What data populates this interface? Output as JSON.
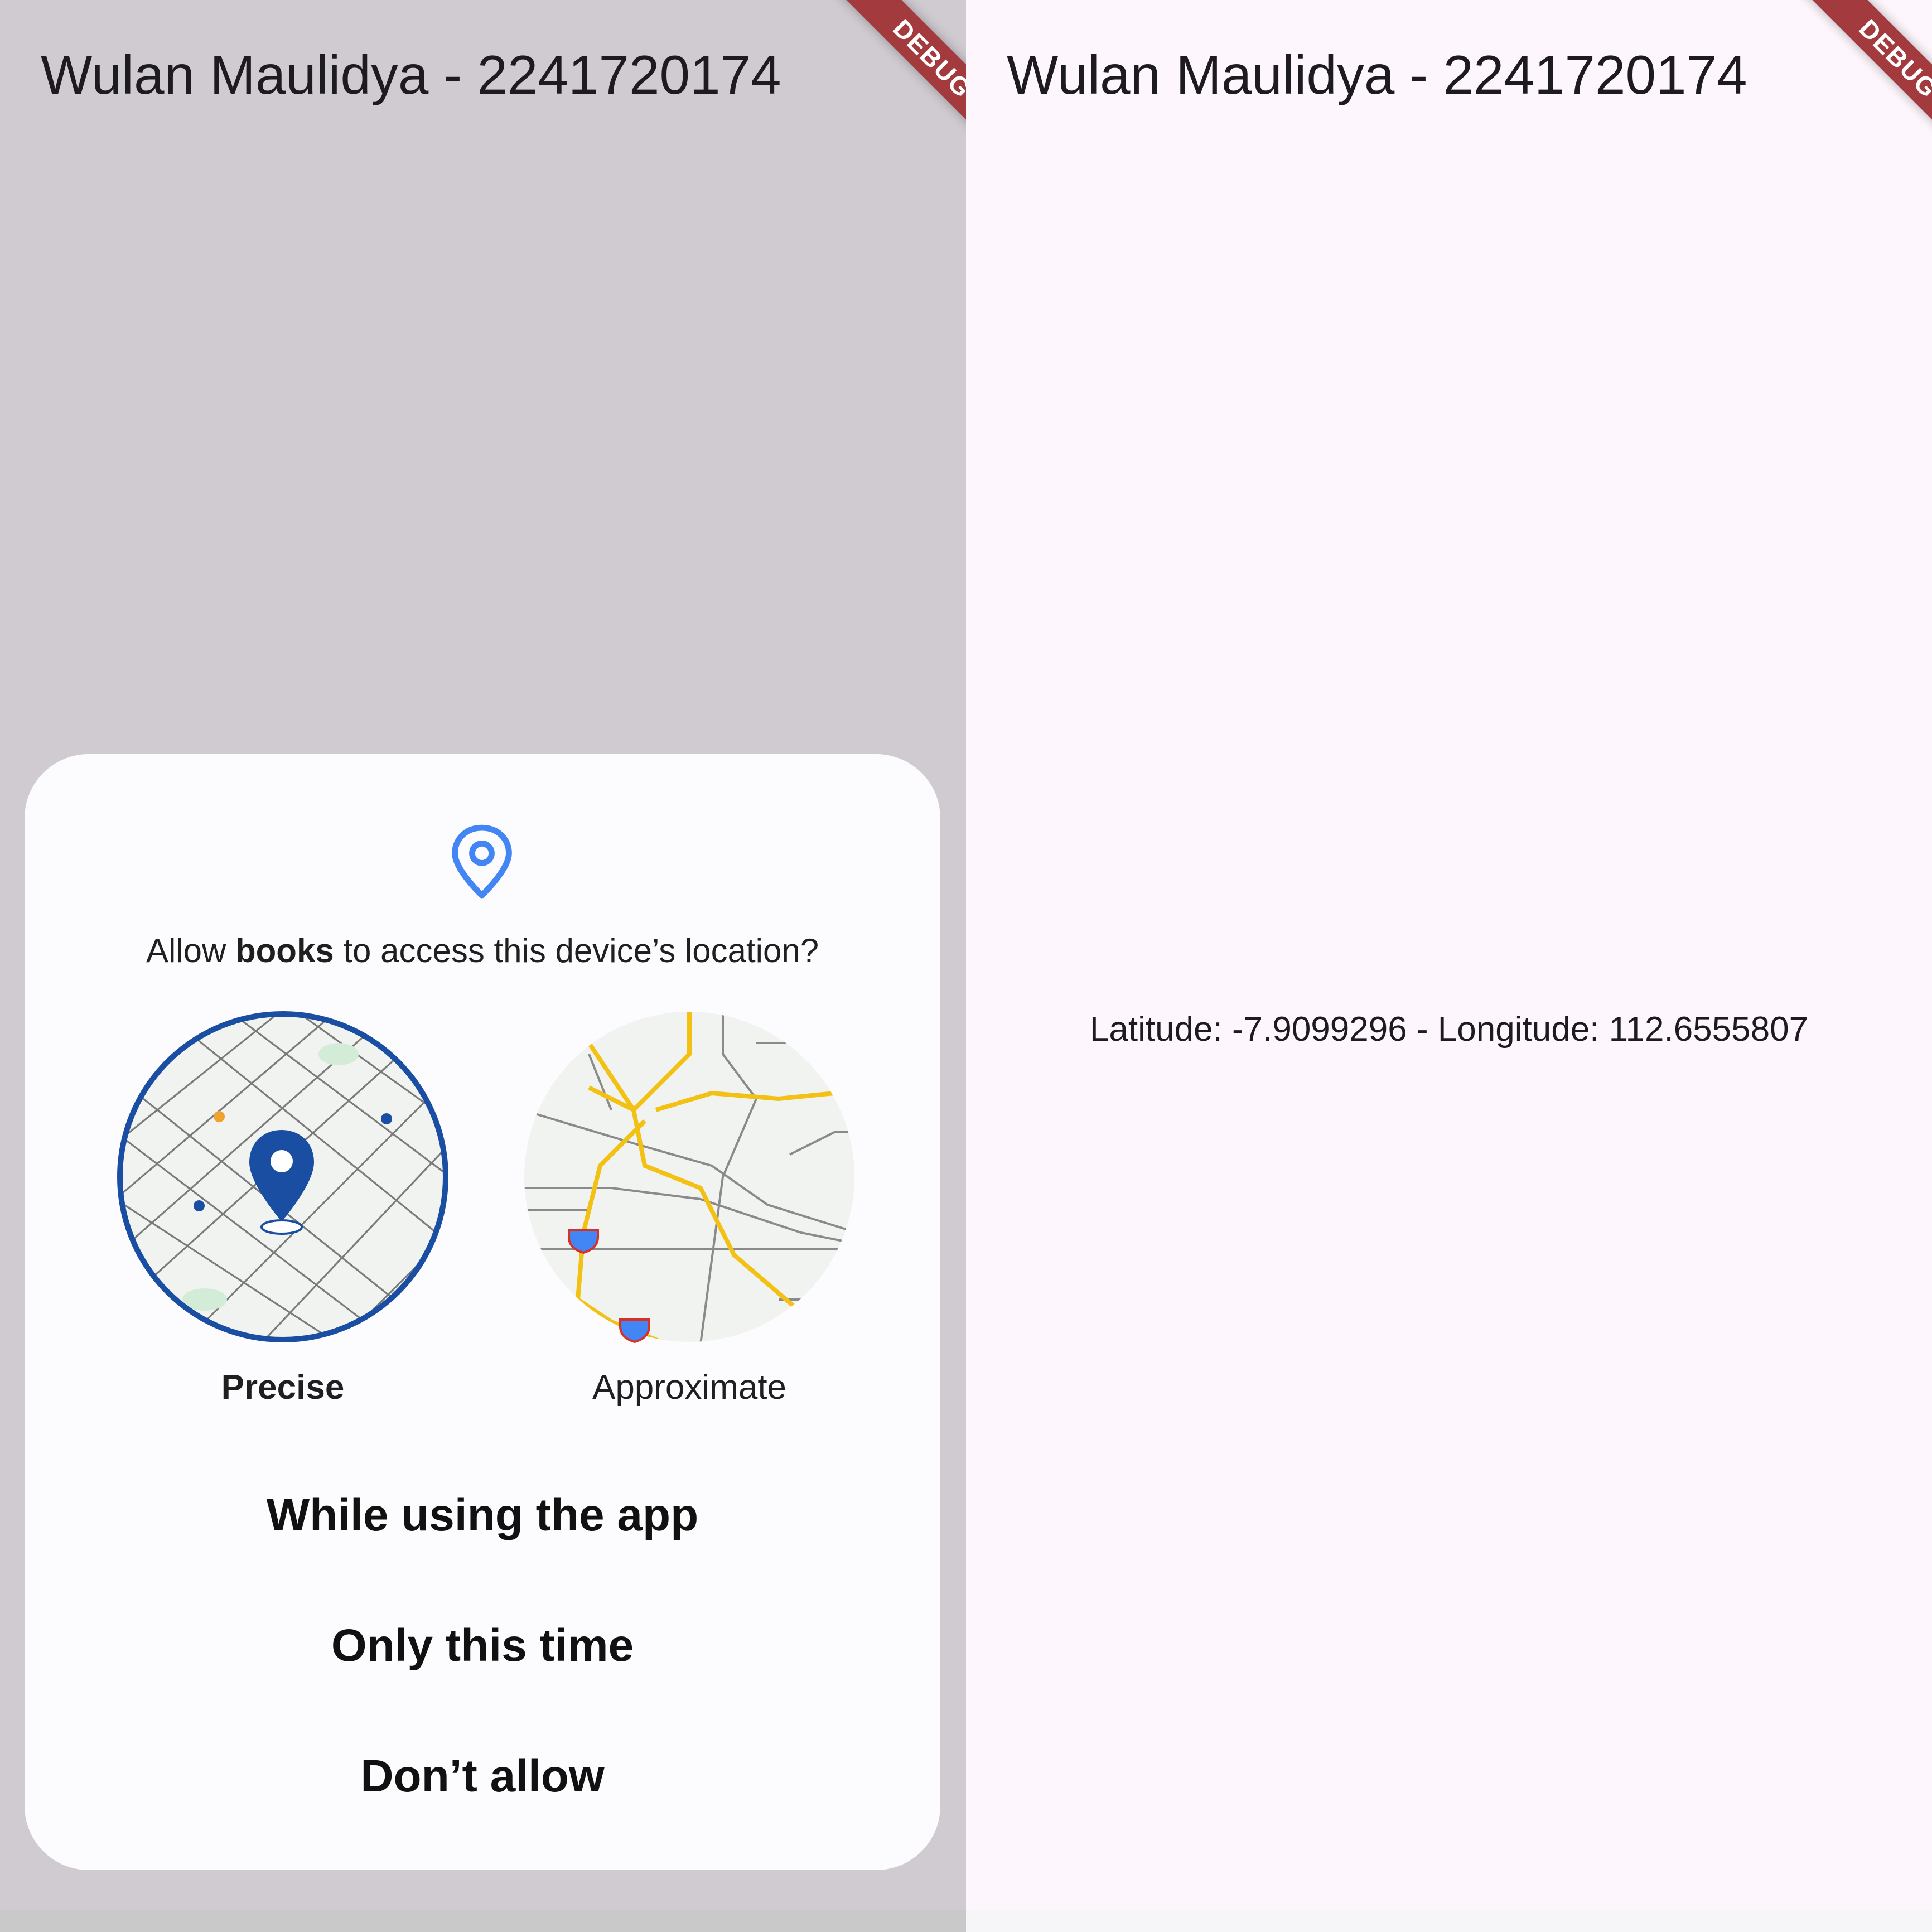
{
  "app": {
    "title": "Wulan Maulidya - 2241720174",
    "debug_banner": "DEBUG"
  },
  "permission_dialog": {
    "icon": "location-pin-icon",
    "question_prefix": "Allow ",
    "app_name": "books",
    "question_suffix": " to access this device’s location?",
    "options": {
      "precise": "Precise",
      "approximate": "Approximate"
    },
    "selected_option": "precise",
    "buttons": {
      "while_using": "While using the app",
      "only_this_time": "Only this time",
      "dont_allow": "Don’t allow"
    }
  },
  "result": {
    "location_text": "Latitude: -7.9099296 - Longitude: 112.6555807"
  },
  "colors": {
    "accent": "#1a4ea3",
    "pin_icon": "#4285f4",
    "road_yellow": "#f3c114",
    "debug_banner": "#a33a3d"
  }
}
